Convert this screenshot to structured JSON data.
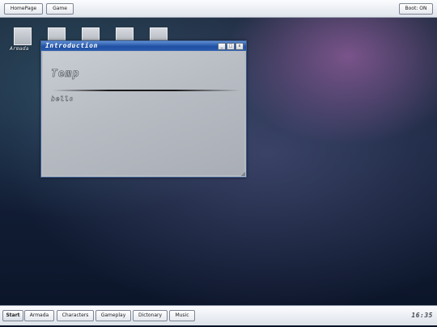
{
  "top_bar": {
    "buttons": [
      "HomePage",
      "Game"
    ],
    "boot_label": "Boot: ON"
  },
  "desktop": {
    "icons": [
      {
        "label": "Armada",
        "icon": "app-icon"
      },
      {
        "label": "",
        "icon": "app-icon"
      },
      {
        "label": "",
        "icon": "app-icon"
      },
      {
        "label": "",
        "icon": "app-icon"
      },
      {
        "label": "",
        "icon": "app-icon"
      }
    ]
  },
  "window": {
    "title": "Introduction",
    "controls": {
      "minimize": "_",
      "maximize": "□",
      "close": "x"
    },
    "heading": "Temp",
    "body": "hello"
  },
  "taskbar": {
    "start_label": "Start",
    "items": [
      "Armada",
      "Characters",
      "Gameplay",
      "Dictonary",
      "Music"
    ],
    "clock": "16:35"
  },
  "colors": {
    "titlebar": "#2a5cb0",
    "window_body": "#b6bbc2",
    "bar_bg": "#eef1f6"
  }
}
